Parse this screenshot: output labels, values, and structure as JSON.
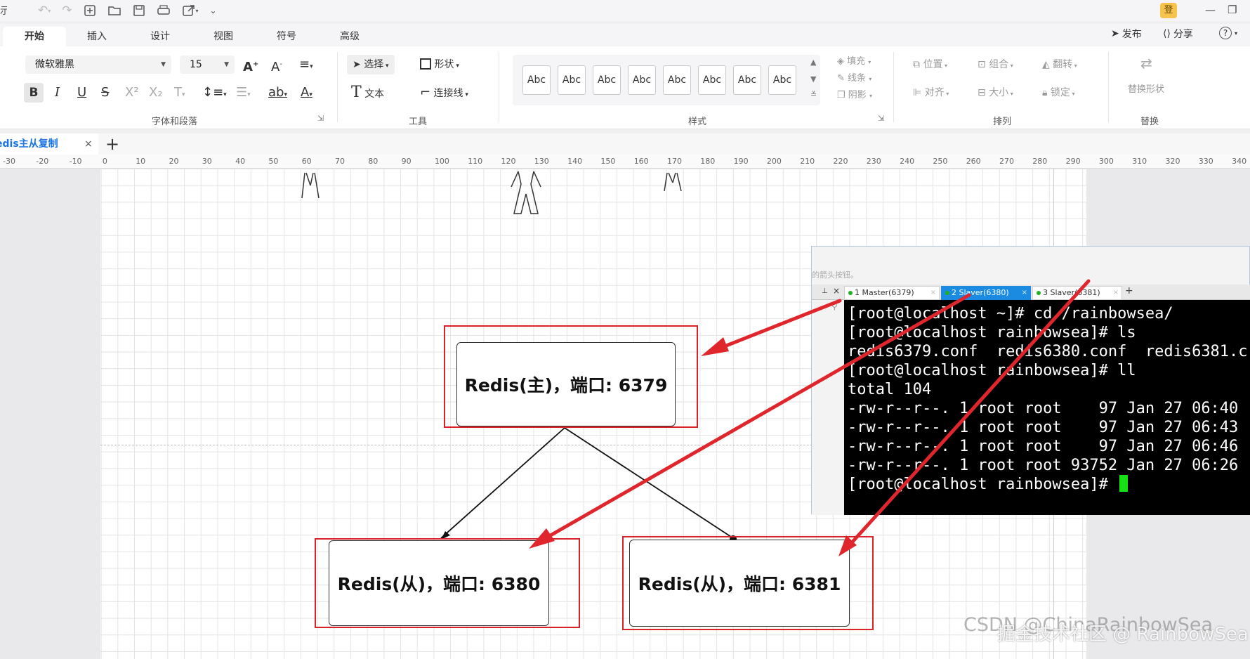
{
  "qat": {
    "left_fragment": "示"
  },
  "account": {
    "login_label": "登"
  },
  "tabs": [
    {
      "label": "开始"
    },
    {
      "label": "插入"
    },
    {
      "label": "设计"
    },
    {
      "label": "视图"
    },
    {
      "label": "符号"
    },
    {
      "label": "高级"
    }
  ],
  "tabs_right": {
    "publish": "发布",
    "share": "分享",
    "help": "?"
  },
  "ribbon": {
    "font_family": "微软雅黑",
    "font_size": "15",
    "group_font": "字体和段落",
    "select_label": "选择",
    "shape_label": "形状",
    "text_label": "文本",
    "connector_label": "连接线",
    "group_tools": "工具",
    "style_abc": [
      "Abc",
      "Abc",
      "Abc",
      "Abc",
      "Abc",
      "Abc",
      "Abc",
      "Abc"
    ],
    "group_style": "样式",
    "fill": "填充",
    "line": "线条",
    "shadow": "阴影",
    "position": "位置",
    "combine": "组合",
    "flip": "翻转",
    "align": "对齐",
    "size": "大小",
    "lock": "锁定",
    "group_arrange": "排列",
    "replace_shape": "替换形状",
    "group_replace": "替换"
  },
  "doc_tab": {
    "title": "edis主从复制",
    "close": "×",
    "add": "+"
  },
  "ruler_ticks": [
    "-30",
    "-20",
    "-10",
    "0",
    "10",
    "20",
    "30",
    "40",
    "50",
    "60",
    "70",
    "80",
    "90",
    "100",
    "110",
    "120",
    "130",
    "140",
    "150",
    "160",
    "170",
    "180",
    "190",
    "200",
    "210",
    "220",
    "230",
    "240",
    "250",
    "260",
    "270",
    "280",
    "290",
    "300",
    "310",
    "320",
    "330",
    "340"
  ],
  "diagram": {
    "master": "Redis(主)，端口: 6379",
    "slave1": "Redis(从)，端口: 6380",
    "slave2": "Redis(从)，端口: 6381"
  },
  "terminal": {
    "hint": "的箭头按钮。",
    "tabs": [
      {
        "label": "1 Master(6379)",
        "active": false
      },
      {
        "label": "2 Slaver(6380)",
        "active": true
      },
      {
        "label": "3 Slaver(6381)",
        "active": false
      }
    ],
    "lines": [
      "[root@localhost ~]# cd /rainbowsea/",
      "[root@localhost rainbowsea]# ls",
      "redis6379.conf  redis6380.conf  redis6381.c",
      "[root@localhost rainbowsea]# ll",
      "total 104",
      "-rw-r--r--. 1 root root    97 Jan 27 06:40",
      "-rw-r--r--. 1 root root    97 Jan 27 06:43",
      "-rw-r--r--. 1 root root    97 Jan 27 06:46",
      "-rw-r--r--. 1 root root 93752 Jan 27 06:26"
    ],
    "prompt": "[root@localhost rainbowsea]# "
  },
  "watermark": {
    "text": "掘金技术社区 @ RainbowSea",
    "text2": "CSDN @ChinaRainbowSea"
  },
  "colors": {
    "highlight": "#d9232b",
    "active_tab": "#1a8be0",
    "terminal_bg": "#000000",
    "cursor": "#14e014"
  }
}
